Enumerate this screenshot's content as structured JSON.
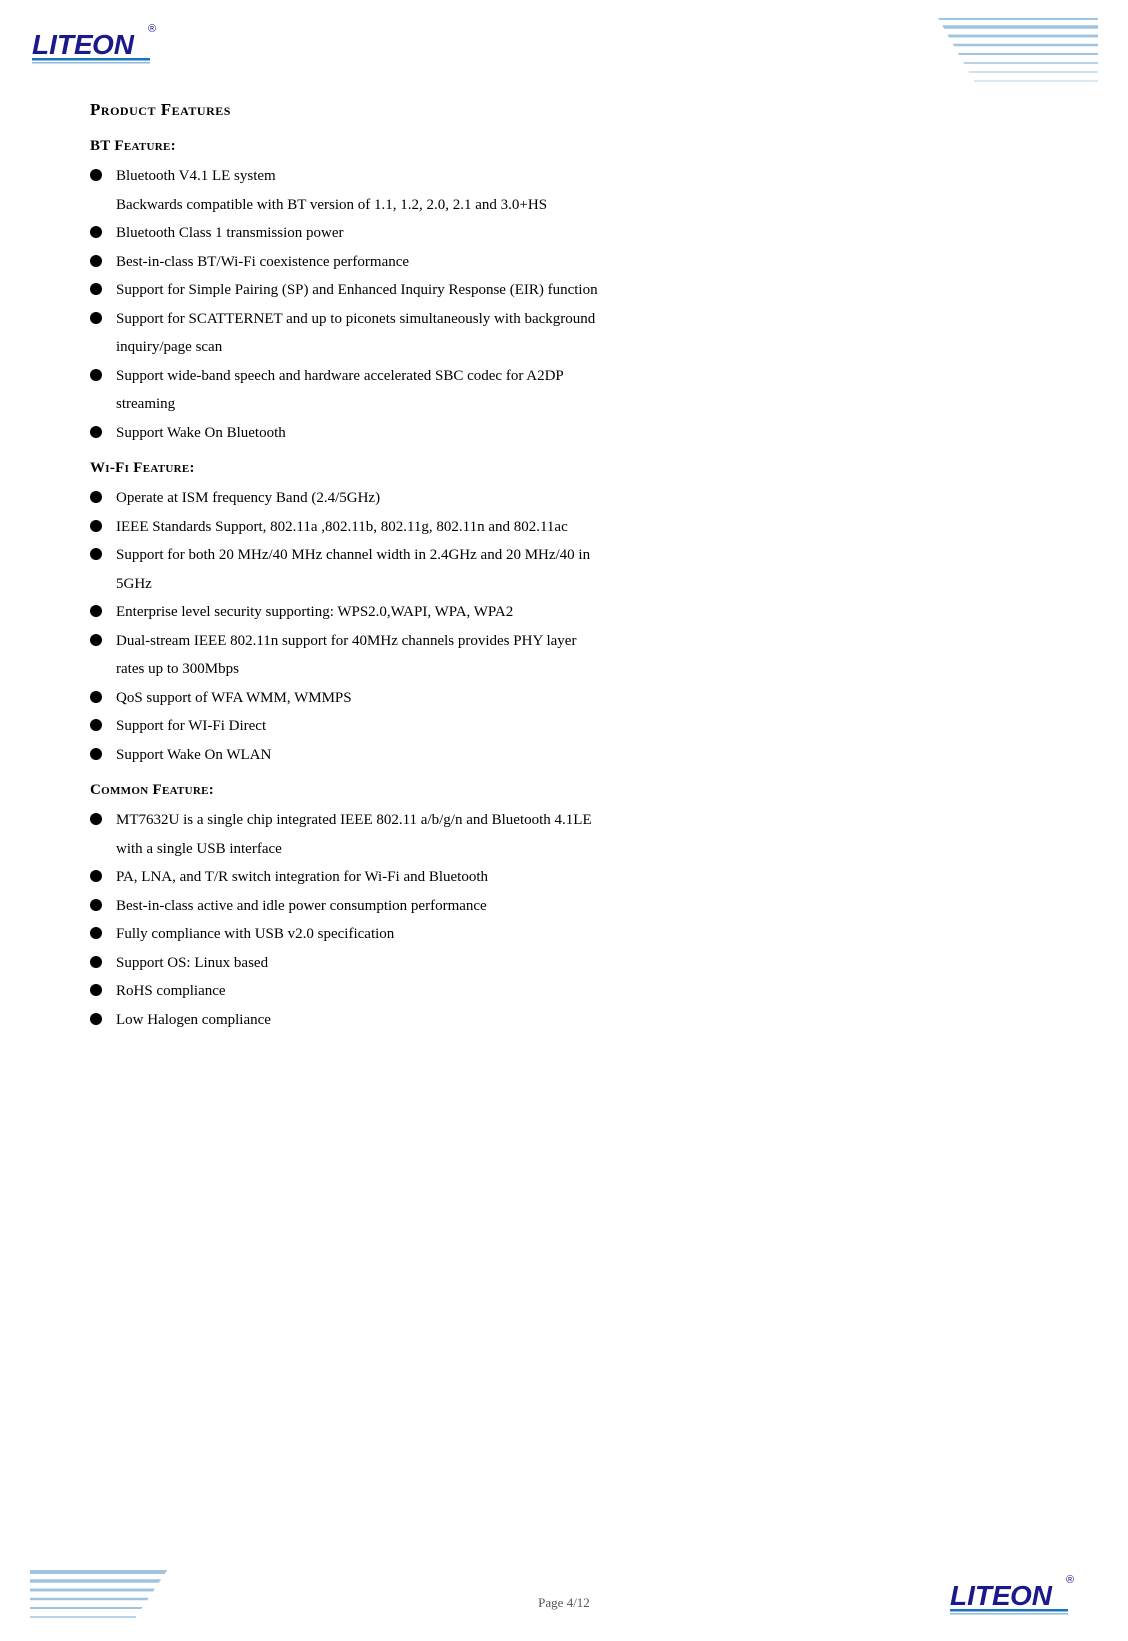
{
  "header": {
    "logo_alt": "LITEON logo",
    "page_label": "Page 4/12"
  },
  "section": {
    "title": "Product Features",
    "bt": {
      "heading": "BT Feature:",
      "items": [
        {
          "text": "Bluetooth V4.1 LE system",
          "sub": "Backwards compatible with BT version of 1.1, 1.2, 2.0, 2.1 and 3.0+HS"
        },
        {
          "text": "Bluetooth Class 1 transmission power",
          "sub": null
        },
        {
          "text": "Best-in-class BT/Wi-Fi coexistence performance",
          "sub": null
        },
        {
          "text": "Support for Simple Pairing (SP) and Enhanced Inquiry Response (EIR) function",
          "sub": null
        },
        {
          "text": "Support for SCATTERNET and up to piconets simultaneously with background",
          "sub": "inquiry/page scan"
        },
        {
          "text": "Support wide-band speech and hardware accelerated SBC codec for A2DP",
          "sub": "streaming"
        },
        {
          "text": "Support Wake On Bluetooth",
          "sub": null
        }
      ]
    },
    "wifi": {
      "heading": "Wi-Fi Feature:",
      "items": [
        {
          "text": "Operate at ISM frequency Band (2.4/5GHz)",
          "sub": null
        },
        {
          "text": "IEEE Standards Support, 802.11a ,802.11b, 802.11g, 802.11n and 802.11ac",
          "sub": null
        },
        {
          "text": "Support for both 20 MHz/40 MHz channel width in 2.4GHz and 20 MHz/40 in",
          "sub": "5GHz"
        },
        {
          "text": "Enterprise level security supporting: WPS2.0,WAPI, WPA, WPA2",
          "sub": null
        },
        {
          "text": "Dual-stream IEEE 802.11n support for 40MHz channels provides PHY layer",
          "sub": "rates up to 300Mbps"
        },
        {
          "text": "QoS support of WFA WMM, WMMPS",
          "sub": null
        },
        {
          "text": "Support for WI-Fi Direct",
          "sub": null
        },
        {
          "text": "Support Wake On WLAN",
          "sub": null
        }
      ]
    },
    "common": {
      "heading": "Common Feature:",
      "items": [
        {
          "text": "MT7632U is a single chip integrated IEEE 802.11 a/b/g/n and Bluetooth 4.1LE",
          "sub": "with a single USB interface"
        },
        {
          "text": "PA, LNA, and T/R switch integration for Wi-Fi and Bluetooth",
          "sub": null
        },
        {
          "text": "Best-in-class active and idle power consumption performance",
          "sub": null
        },
        {
          "text": "Fully compliance with USB v2.0 specification",
          "sub": null
        },
        {
          "text": "Support OS: Linux based",
          "sub": null
        },
        {
          "text": "RoHS compliance",
          "sub": null
        },
        {
          "text": "Low Halogen compliance",
          "sub": null
        }
      ]
    }
  }
}
